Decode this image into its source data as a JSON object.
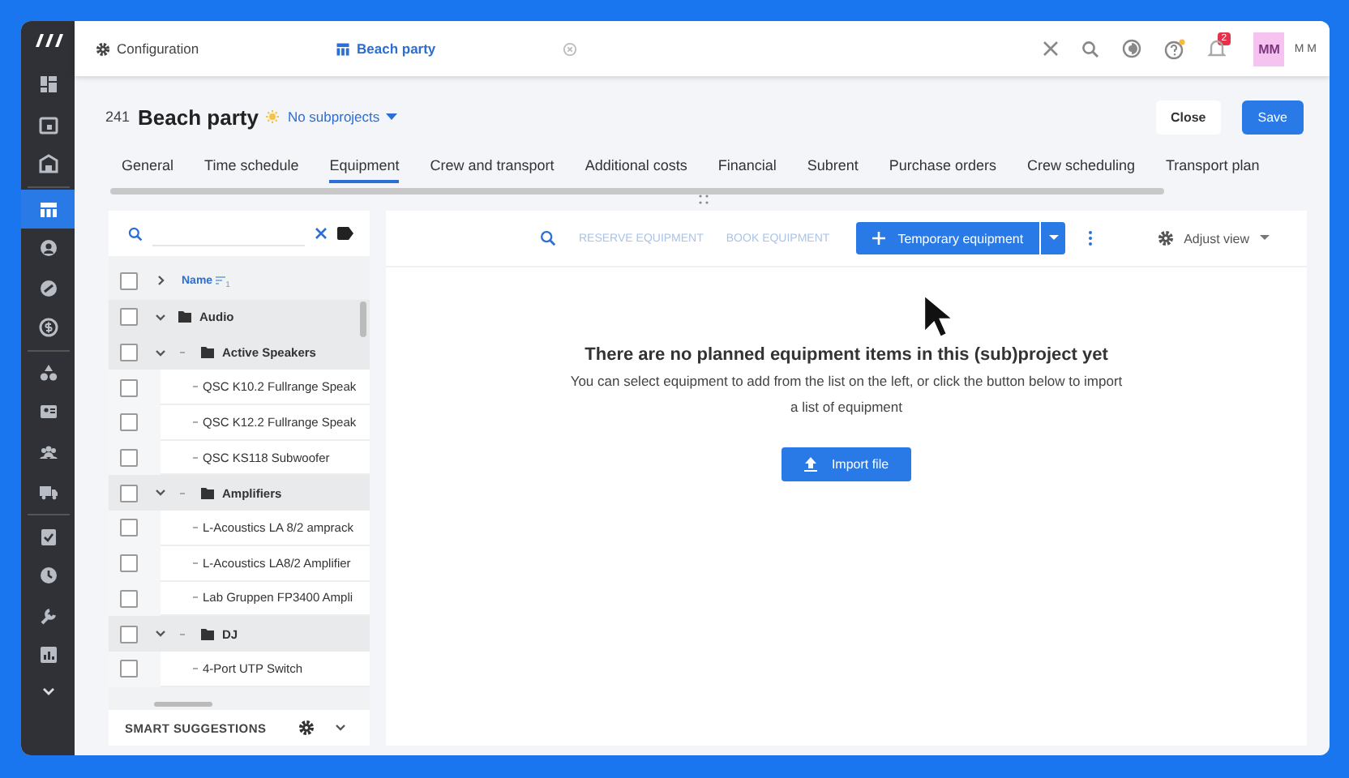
{
  "sidebar": {
    "items": [
      {
        "selected": false
      },
      {
        "selected": false
      },
      {
        "selected": false
      },
      {
        "selected": true
      },
      {
        "selected": false
      },
      {
        "selected": false
      },
      {
        "selected": false
      },
      {
        "selected": false
      },
      {
        "selected": false
      },
      {
        "selected": false
      },
      {
        "selected": false
      },
      {
        "selected": false
      },
      {
        "selected": false
      },
      {
        "selected": false
      },
      {
        "selected": false
      }
    ]
  },
  "top_bar": {
    "tabs": [
      {
        "label": "Configuration",
        "kind": "settings",
        "selected": false
      },
      {
        "label": "Beach party",
        "kind": "project",
        "selected": true
      }
    ],
    "notification_count": "2",
    "avatar": "MM",
    "user": "M M"
  },
  "project": {
    "number": "241",
    "title": "Beach party",
    "subprojects": "No subprojects"
  },
  "actions": {
    "close": "Close",
    "save": "Save"
  },
  "tabs": [
    {
      "label": "General",
      "selected": false
    },
    {
      "label": "Time schedule",
      "selected": false
    },
    {
      "label": "Equipment",
      "selected": true
    },
    {
      "label": "Crew and transport",
      "selected": false
    },
    {
      "label": "Additional costs",
      "selected": false
    },
    {
      "label": "Financial",
      "selected": false
    },
    {
      "label": "Subrent",
      "selected": false
    },
    {
      "label": "Purchase orders",
      "selected": false
    },
    {
      "label": "Crew scheduling",
      "selected": false
    },
    {
      "label": "Transport plan",
      "selected": false
    }
  ],
  "tree": {
    "header": {
      "label": "Name",
      "sort_mark": "1",
      "checked": false,
      "expanded": false
    },
    "items": [
      {
        "label": "Audio",
        "kind": "folder",
        "checked": false,
        "expanded": true,
        "children": [
          {
            "label": "Active Speakers",
            "kind": "folder",
            "checked": false,
            "expanded": true,
            "children": [
              {
                "label": "QSC K10.2 Fullrange Speak",
                "kind": "item",
                "checked": false
              },
              {
                "label": "QSC K12.2 Fullrange Speak",
                "kind": "item",
                "checked": false
              },
              {
                "label": "QSC KS118 Subwoofer",
                "kind": "item",
                "checked": false
              }
            ]
          },
          {
            "label": "Amplifiers",
            "kind": "folder",
            "checked": false,
            "expanded": true,
            "children": [
              {
                "label": "L-Acoustics LA 8/2 amprack",
                "kind": "item",
                "checked": false
              },
              {
                "label": "L-Acoustics LA8/2 Amplifier",
                "kind": "item",
                "checked": false
              },
              {
                "label": "Lab Gruppen FP3400 Ampli",
                "kind": "item",
                "checked": false
              }
            ]
          },
          {
            "label": "DJ",
            "kind": "folder",
            "checked": false,
            "expanded": true,
            "children": [
              {
                "label": "4-Port UTP Switch",
                "kind": "item",
                "checked": false
              }
            ]
          }
        ]
      }
    ]
  },
  "smart_suggestions": {
    "label": "SMART SUGGESTIONS"
  },
  "toolbar": {
    "actions": [
      {
        "label": "RESERVE EQUIPMENT",
        "disabled": true
      },
      {
        "label": "BOOK EQUIPMENT",
        "disabled": true
      }
    ],
    "primary": "Temporary equipment",
    "adjust_view": "Adjust view"
  },
  "empty_state": {
    "title": "There are no planned equipment items in this (sub)project yet",
    "message": "You can select equipment to add from the list on the left, or click the button below to import a list of equipment",
    "button": "Import file"
  }
}
